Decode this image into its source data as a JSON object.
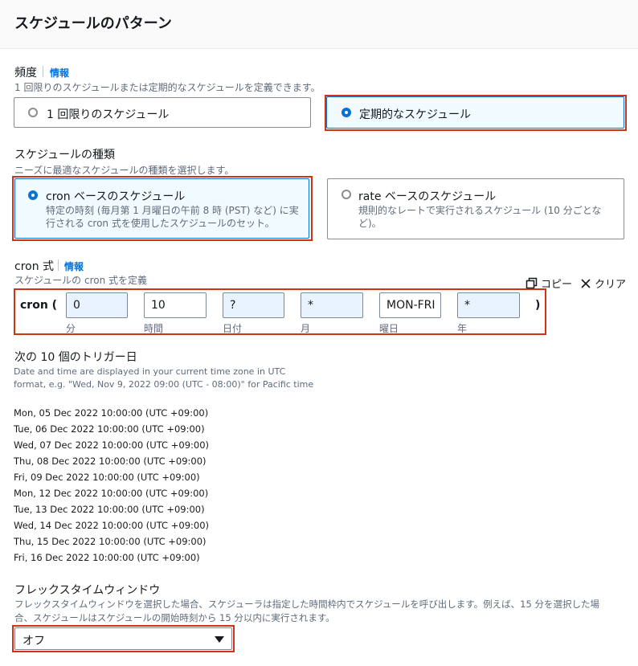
{
  "header": {
    "title": "スケジュールのパターン"
  },
  "frequency": {
    "label": "頻度",
    "info": "情報",
    "description": "1 回限りのスケジュールまたは定期的なスケジュールを定義できます。",
    "options": [
      {
        "label": "1 回限りのスケジュール",
        "selected": false
      },
      {
        "label": "定期的なスケジュール",
        "selected": true
      }
    ]
  },
  "schedule_type": {
    "label": "スケジュールの種類",
    "description": "ニーズに最適なスケジュールの種類を選択します。",
    "options": [
      {
        "label": "cron ベースのスケジュール",
        "sub_line1": "特定の時刻 (毎月第 1 月曜日の午前 8 時 (PST) など) に実",
        "sub_line2": "行される cron 式を使用したスケジュールのセット。",
        "selected": true
      },
      {
        "label": "rate ベースのスケジュール",
        "sub_line1": "規則的なレートで実行されるスケジュール (10 分ごとな",
        "sub_line2": "ど)。",
        "selected": false
      }
    ]
  },
  "cron": {
    "label": "cron 式",
    "info": "情報",
    "description": "スケジュールの cron 式を定義",
    "copy_label": "コピー",
    "clear_label": "クリア",
    "prefix": "cron (",
    "suffix": ")",
    "fields": [
      {
        "value": "0",
        "label": "分"
      },
      {
        "value": "10",
        "label": "時間"
      },
      {
        "value": "?",
        "label": "日付"
      },
      {
        "value": "*",
        "label": "月"
      },
      {
        "value": "MON-FRI",
        "label": "曜日"
      },
      {
        "value": "*",
        "label": "年"
      }
    ]
  },
  "triggers": {
    "title": "次の 10 個のトリガー日",
    "note_line1": "Date and time are displayed in your current time zone in UTC",
    "note_line2": "format, e.g. \"Wed, Nov 9, 2022 09:00 (UTC - 08:00)\" for Pacific time",
    "dates": [
      "Mon, 05 Dec 2022 10:00:00 (UTC +09:00)",
      "Tue, 06 Dec 2022 10:00:00 (UTC +09:00)",
      "Wed, 07 Dec 2022 10:00:00 (UTC +09:00)",
      "Thu, 08 Dec 2022 10:00:00 (UTC +09:00)",
      "Fri, 09 Dec 2022 10:00:00 (UTC +09:00)",
      "Mon, 12 Dec 2022 10:00:00 (UTC +09:00)",
      "Tue, 13 Dec 2022 10:00:00 (UTC +09:00)",
      "Wed, 14 Dec 2022 10:00:00 (UTC +09:00)",
      "Thu, 15 Dec 2022 10:00:00 (UTC +09:00)",
      "Fri, 16 Dec 2022 10:00:00 (UTC +09:00)"
    ]
  },
  "flex": {
    "label": "フレックスタイムウィンドウ",
    "desc_line1": "フレックスタイムウィンドウを選択した場合、スケジューラは指定した時間枠内でスケジュールを呼び出します。例えば、15 分を選択した場",
    "desc_line2": "合、スケジュールはスケジュールの開始時刻から 15 分以内に実行されます。",
    "selected": "オフ"
  },
  "colors": {
    "accent": "#0972d3",
    "highlight": "#d13212",
    "field_fill": "#e9f2ff"
  }
}
